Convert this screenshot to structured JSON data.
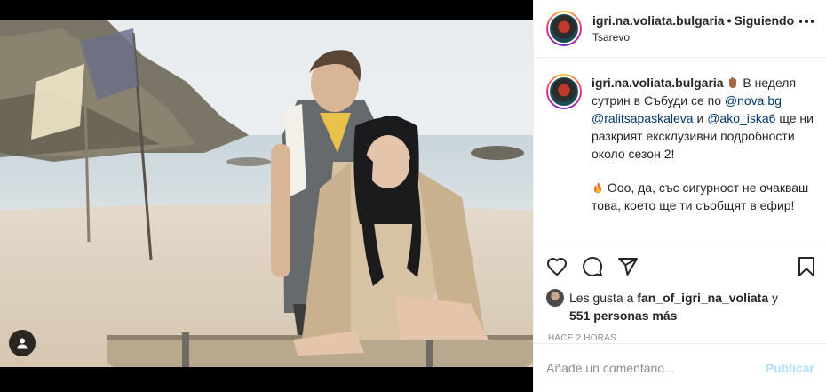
{
  "post": {
    "username": "igri.na.voliata.bulgaria",
    "separator": "•",
    "follow_status": "Siguiendo",
    "location": "Tsarevo",
    "more_icon": "more-options-icon"
  },
  "caption": {
    "username": "igri.na.voliata.bulgaria",
    "line1_text_a": " В неделя сутрин в Събуди се по ",
    "mention1": "@nova.bg",
    "space": " ",
    "mention2": "@ralitsapaskaleva",
    "and": " и ",
    "mention3": "@ako_iska6",
    "line1_text_b": " ще ни разкрият ексклузивни подробности около сезон 2!",
    "line2_text": " Ооо, да, със сигурност не очакваш това, което ще ти съобщят в ефир!",
    "emoji1": "hand-emoji",
    "emoji2": "fire-emoji"
  },
  "actions": {
    "like": "heart-icon",
    "comment": "comment-icon",
    "share": "share-icon",
    "save": "bookmark-icon"
  },
  "likes": {
    "prefix": "Les gusta a ",
    "user": "fan_of_igri_na_voliata",
    "middle": " y ",
    "count": "551 personas más"
  },
  "timestamp": "Hace 2 horas",
  "comment_box": {
    "placeholder": "Añade un comentario...",
    "post_label": "Publicar"
  },
  "colors": {
    "mention": "#00376b",
    "post_button_disabled": "#b2dffc",
    "muted": "#8e8e8e"
  }
}
